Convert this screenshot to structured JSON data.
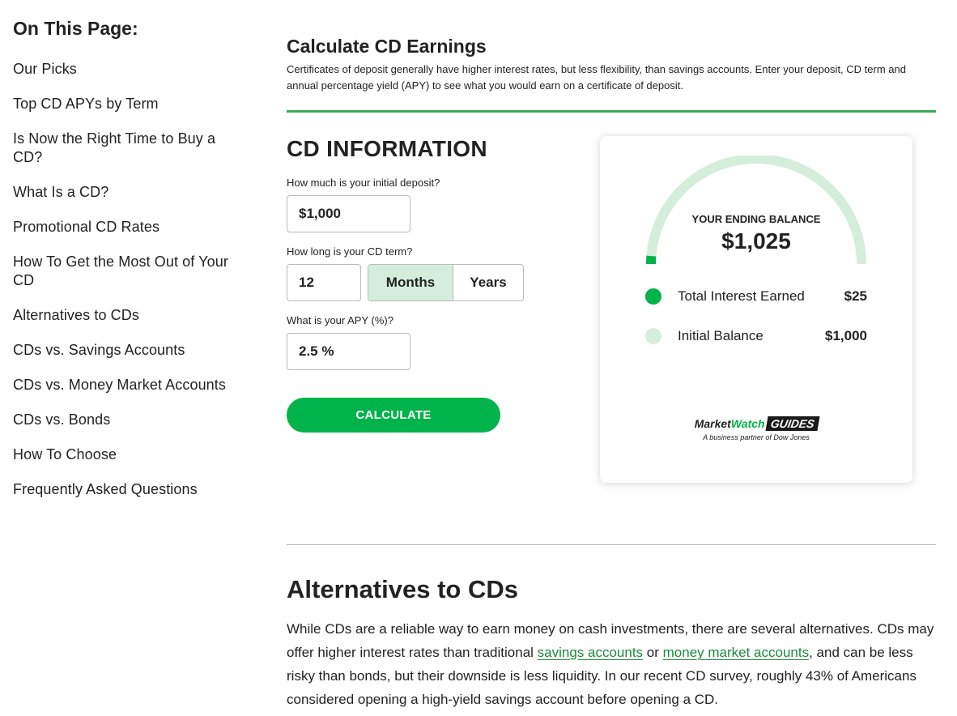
{
  "sidebar": {
    "heading": "On This Page:",
    "items": [
      {
        "label": "Our Picks"
      },
      {
        "label": "Top CD APYs by Term"
      },
      {
        "label": "Is Now the Right Time to Buy a CD?"
      },
      {
        "label": "What Is a CD?"
      },
      {
        "label": "Promotional CD Rates"
      },
      {
        "label": "How To Get the Most Out of Your CD"
      },
      {
        "label": "Alternatives to CDs"
      },
      {
        "label": "CDs vs. Savings Accounts"
      },
      {
        "label": "CDs vs. Money Market Accounts"
      },
      {
        "label": "CDs vs. Bonds"
      },
      {
        "label": "How To Choose"
      },
      {
        "label": "Frequently Asked Questions"
      }
    ]
  },
  "calculator": {
    "title": "Calculate CD Earnings",
    "description": "Certificates of deposit generally have higher interest rates, but less flexibility, than savings accounts. Enter your deposit, CD term and annual percentage yield (APY) to see what you would earn on a certificate of deposit.",
    "form": {
      "heading": "CD INFORMATION",
      "deposit_label": "How much is your initial deposit?",
      "deposit_value": "$1,000",
      "term_label": "How long is your CD term?",
      "term_value": "12",
      "term_unit_months": "Months",
      "term_unit_years": "Years",
      "term_unit_selected": "Months",
      "apy_label": "What is your APY (%)?",
      "apy_value": "2.5 %",
      "calculate_button": "CALCULATE"
    },
    "result": {
      "ending_balance_label": "YOUR ENDING BALANCE",
      "ending_balance_value": "$1,025",
      "interest_fraction": 0.0244,
      "legend": [
        {
          "label": "Total Interest Earned",
          "value": "$25",
          "color": "#00b34b"
        },
        {
          "label": "Initial Balance",
          "value": "$1,000",
          "color": "#d5eedc"
        }
      ],
      "logo_text_market": "Market",
      "logo_text_watch": "Watch",
      "logo_text_guides": "GUIDES",
      "logo_tagline": "A business partner of Dow Jones"
    }
  },
  "article": {
    "heading": "Alternatives to CDs",
    "para_part1": "While CDs are a reliable way to earn money on cash investments, there are several alternatives. CDs may offer higher interest rates than traditional ",
    "link1": "savings accounts",
    "para_part2": " or ",
    "link2": "money market accounts",
    "para_part3": ", and can be less risky than bonds, but their downside is less liquidity. In our recent CD survey, roughly 43% of Americans considered opening a high-yield savings account before opening a CD."
  },
  "colors": {
    "accent_green": "#00b34b",
    "light_green": "#d5eedc",
    "rule_green": "#3daa5a",
    "link_green": "#1b8a3a"
  }
}
